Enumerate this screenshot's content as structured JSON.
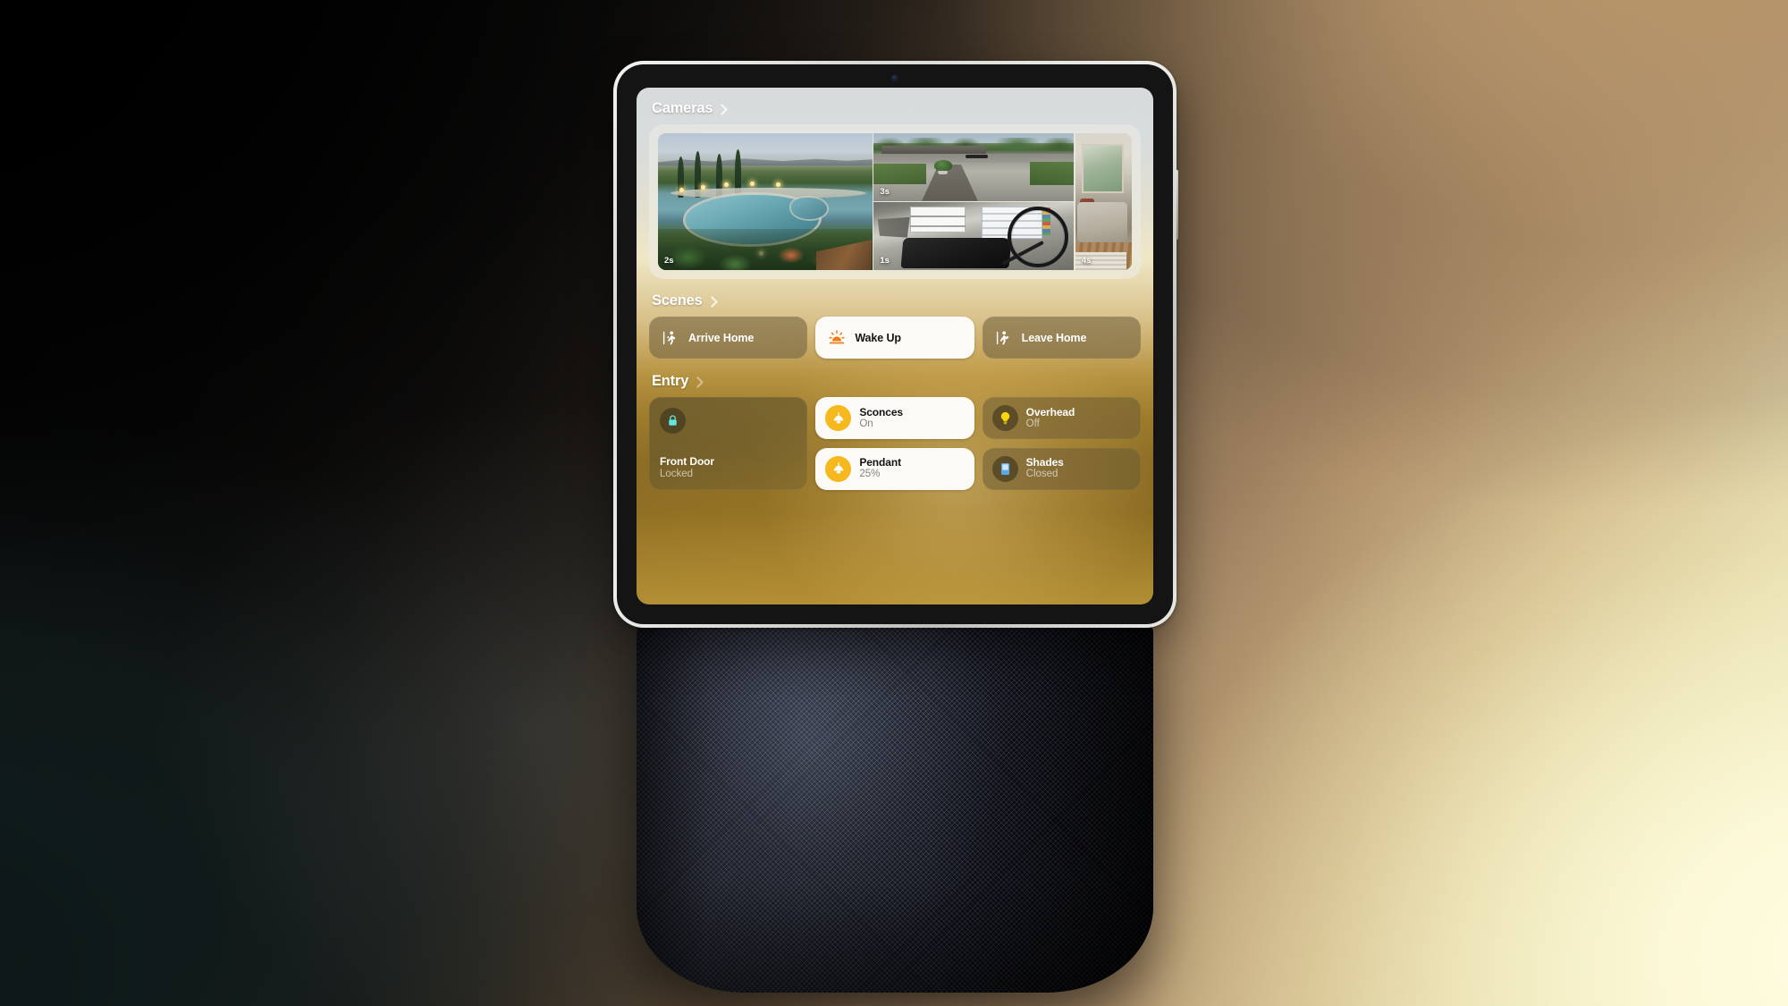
{
  "device": {
    "type": "smart-display-speaker",
    "camera_dot": "front-camera"
  },
  "screen": {
    "cameras": {
      "header": "Cameras",
      "tiles": [
        {
          "name": "pool-camera",
          "timestamp": "2s"
        },
        {
          "name": "driveway-camera",
          "timestamp": "3s"
        },
        {
          "name": "garage-camera",
          "timestamp": "1s"
        },
        {
          "name": "living-room-camera",
          "timestamp": "4s"
        }
      ]
    },
    "scenes": {
      "header": "Scenes",
      "tiles": [
        {
          "label": "Arrive Home",
          "icon": "walk-in-icon",
          "active": false
        },
        {
          "label": "Wake Up",
          "icon": "sunrise-icon",
          "active": true
        },
        {
          "label": "Leave Home",
          "icon": "walk-out-icon",
          "active": false
        }
      ]
    },
    "entry": {
      "header": "Entry",
      "lock": {
        "name": "Front Door",
        "state": "Locked",
        "icon": "lock-closed-icon",
        "icon_color": "#5fe8dc"
      },
      "devices": [
        {
          "name": "Sconces",
          "state": "On",
          "icon": "pendant-lamp-icon",
          "on": true
        },
        {
          "name": "Overhead",
          "state": "Off",
          "icon": "bulb-icon",
          "on": false
        },
        {
          "name": "Pendant",
          "state": "25%",
          "icon": "pendant-lamp-icon",
          "on": true
        },
        {
          "name": "Shades",
          "state": "Closed",
          "icon": "shade-icon",
          "on": false
        }
      ]
    }
  },
  "colors": {
    "amber": "#f5b81d",
    "orange": "#f07c18",
    "lock_cyan": "#5fe8dc",
    "bulb_yellow": "#ffd60a",
    "shade_blue": "#5aa9e6",
    "tile_active_bg": "#fbfaf7"
  }
}
